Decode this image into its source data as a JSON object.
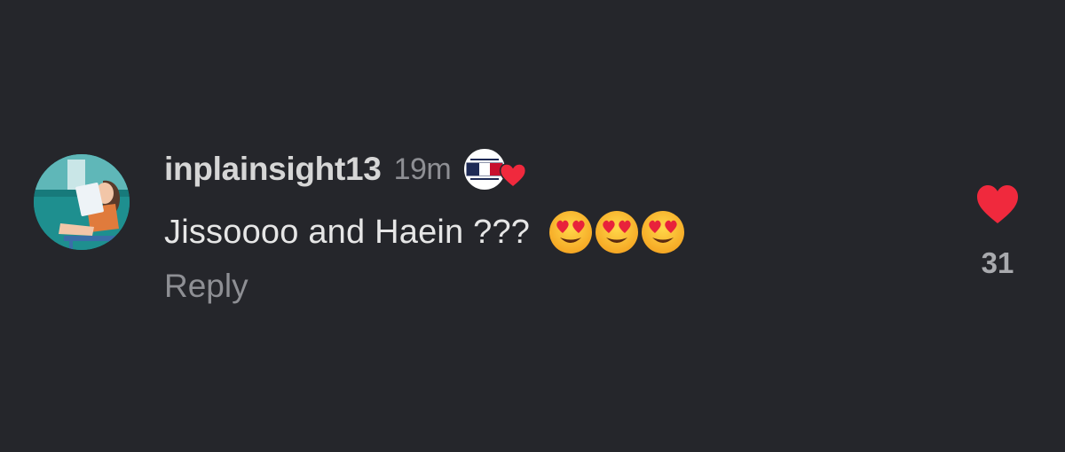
{
  "comment": {
    "username": "inplainsight13",
    "timestamp": "19m",
    "text": "Jissoooo and Haein ???",
    "emojis": [
      "heart-eyes-emoji",
      "heart-eyes-emoji",
      "heart-eyes-emoji"
    ],
    "reply_label": "Reply",
    "like_count": "31",
    "like_color": "#f0293d",
    "badge_icon": "brand-flag-heart-badge"
  }
}
